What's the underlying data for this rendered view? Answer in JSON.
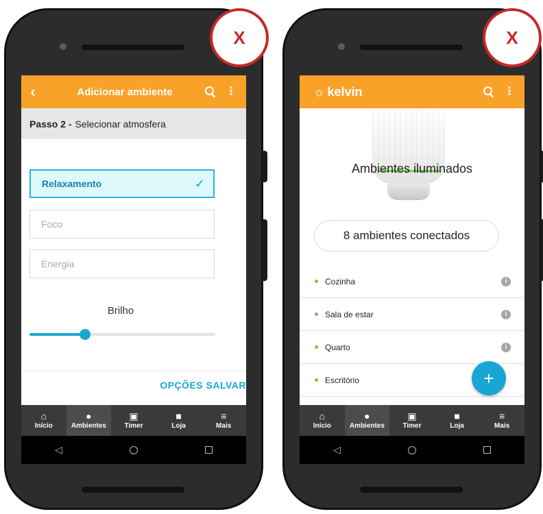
{
  "left_screen": {
    "header": {
      "back_icon": "chevron-left-icon",
      "title": "Adicionar ambiente"
    },
    "step": {
      "label": "Passo 2 -",
      "text": "Selecionar atmosfera"
    },
    "options": [
      {
        "label": "Relaxamento",
        "selected": true
      },
      {
        "label": "Foco",
        "selected": false
      },
      {
        "label": "Energia",
        "selected": false
      }
    ],
    "brightness": {
      "label": "Brilho",
      "value_fraction": 0.3
    },
    "save_label": "OPÇÕES SALVAR",
    "badge": "X"
  },
  "right_screen": {
    "header": {
      "app_name": "kelvin"
    },
    "title": "Ambientes iluminados",
    "connected": "8 ambientes conectados",
    "rooms": [
      {
        "name": "Cozinha",
        "status": "on"
      },
      {
        "name": "Sala de estar",
        "status": "off"
      },
      {
        "name": "Quarto",
        "status": "on"
      },
      {
        "name": "Escritório",
        "status": "on"
      }
    ],
    "fab_label": "+",
    "badge": "X"
  },
  "nav": {
    "items": [
      {
        "label": "Início",
        "icon": "home-icon"
      },
      {
        "label": "Ambientes",
        "icon": "bulb-icon"
      },
      {
        "label": "Timer",
        "icon": "calendar-icon"
      },
      {
        "label": "Loja",
        "icon": "lock-icon"
      },
      {
        "label": "Mais",
        "icon": "menu-icon"
      }
    ],
    "active": "Ambientes"
  },
  "colors": {
    "accent": "#f9a229",
    "primary": "#1aa6d4",
    "badge_red": "#c62828"
  }
}
